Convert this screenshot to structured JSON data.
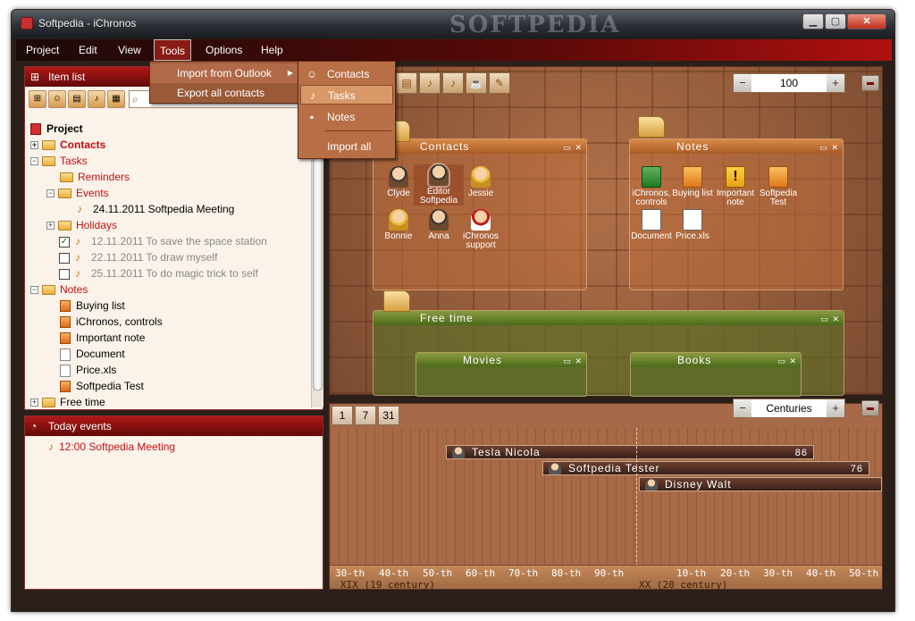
{
  "window": {
    "title": "Softpedia - iChronos",
    "watermark": "SOFTPEDIA"
  },
  "menubar": [
    "Project",
    "Edit",
    "View",
    "Tools",
    "Options",
    "Help"
  ],
  "tools_menu": {
    "items": [
      "Import from Outlook",
      "Export all contacts"
    ]
  },
  "submenu": {
    "items": [
      "Contacts",
      "Tasks",
      "Notes",
      "Import all"
    ]
  },
  "item_list": {
    "header": "Item list",
    "tree": [
      {
        "label": "Project"
      },
      {
        "label": "Contacts"
      },
      {
        "label": "Tasks"
      },
      {
        "label": "Reminders"
      },
      {
        "label": "Events"
      },
      {
        "label": "24.11.2011  Softpedia Meeting"
      },
      {
        "label": "Holidays"
      },
      {
        "label": "12.11.2011  To save the space station"
      },
      {
        "label": "22.11.2011  To draw myself"
      },
      {
        "label": "25.11.2011  To do magic trick to self"
      },
      {
        "label": "Notes"
      },
      {
        "label": "Buying list"
      },
      {
        "label": "iChronos, controls"
      },
      {
        "label": "Important note"
      },
      {
        "label": "Document"
      },
      {
        "label": "Price.xls"
      },
      {
        "label": "Softpedia Test"
      },
      {
        "label": "Free time"
      }
    ]
  },
  "today": {
    "header": "Today events",
    "event": "12:00 Softpedia Meeting"
  },
  "canvas": {
    "zoom": "100",
    "groups": {
      "contacts": "Contacts",
      "notes": "Notes",
      "free_time": "Free  time",
      "movies": "Movies",
      "books": "Books"
    },
    "contacts": [
      {
        "line1": "Clyde",
        "line2": ""
      },
      {
        "line1": "Editor",
        "line2": "Softpedia"
      },
      {
        "line1": "Jessie",
        "line2": ""
      },
      {
        "line1": "Bonnie",
        "line2": ""
      },
      {
        "line1": "Anna",
        "line2": ""
      },
      {
        "line1": "iChronos",
        "line2": "support"
      }
    ],
    "notes": [
      {
        "line1": "iChronos,",
        "line2": "controls"
      },
      {
        "line1": "Buying  list",
        "line2": ""
      },
      {
        "line1": "Important",
        "line2": "note"
      },
      {
        "line1": "Softpedia",
        "line2": "Test"
      },
      {
        "line1": "Document",
        "line2": ""
      },
      {
        "line1": "Price.xls",
        "line2": ""
      }
    ]
  },
  "timeline": {
    "tabs": [
      "1",
      "7",
      "31"
    ],
    "scale": "Centuries",
    "bars": [
      {
        "name": "Tesla  Nicola",
        "value": "86"
      },
      {
        "name": "Softpedia  Tester",
        "value": "76"
      },
      {
        "name": "Disney  Walt",
        "value": ""
      }
    ],
    "ticks_left": [
      "30-th",
      "40-th",
      "50-th",
      "60-th",
      "70-th",
      "80-th",
      "90-th"
    ],
    "ticks_right": [
      "10-th",
      "20-th",
      "30-th",
      "40-th",
      "50-th"
    ],
    "century_left": "XIX (19 century)",
    "century_right": "XX (20 century)"
  }
}
